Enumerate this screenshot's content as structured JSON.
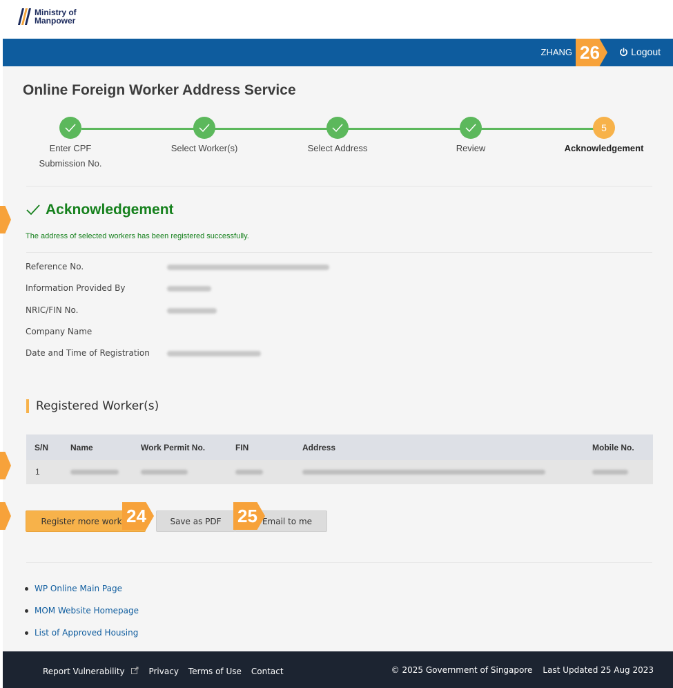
{
  "header": {
    "logo_line1": "Ministry of",
    "logo_line2": "Manpower",
    "user_name": "ZHANG",
    "logout_label": "Logout"
  },
  "page": {
    "title": "Online Foreign Worker Address Service"
  },
  "steps": [
    {
      "label": "Enter CPF\nSubmission No.",
      "state": "done"
    },
    {
      "label": "Select Worker(s)",
      "state": "done"
    },
    {
      "label": "Select Address",
      "state": "done"
    },
    {
      "label": "Review",
      "state": "done"
    },
    {
      "label": "Acknowledgement",
      "state": "active",
      "number": "5"
    }
  ],
  "ack": {
    "title": "Acknowledgement",
    "message": "The address of selected workers has been registered successfully."
  },
  "info": [
    {
      "label": "Reference No."
    },
    {
      "label": "Information Provided By"
    },
    {
      "label": "NRIC/FIN No."
    },
    {
      "label": "Company Name"
    },
    {
      "label": "Date and Time of Registration"
    }
  ],
  "workers": {
    "section_title": "Registered Worker(s)",
    "columns": [
      "S/N",
      "Name",
      "Work Permit No.",
      "FIN",
      "Address",
      "Mobile No."
    ],
    "rows": [
      {
        "sn": "1"
      }
    ]
  },
  "actions": {
    "register_more": "Register more worker",
    "save_pdf": "Save as PDF",
    "email_me": "Email to me"
  },
  "links": [
    "WP Online Main Page",
    "MOM Website Homepage",
    "List of Approved Housing"
  ],
  "footer": {
    "report": "Report Vulnerability",
    "privacy": "Privacy",
    "terms": "Terms of Use",
    "contact": "Contact",
    "copyright": "© 2025 Government of Singapore",
    "updated": "Last Updated 25 Aug 2023"
  },
  "badges": {
    "b26": "26",
    "b24": "24",
    "b25": "25"
  },
  "colors": {
    "topbar": "#0e5c9e",
    "success": "#16811d",
    "accent": "#f7b24a",
    "step_done": "#5cb85c"
  }
}
